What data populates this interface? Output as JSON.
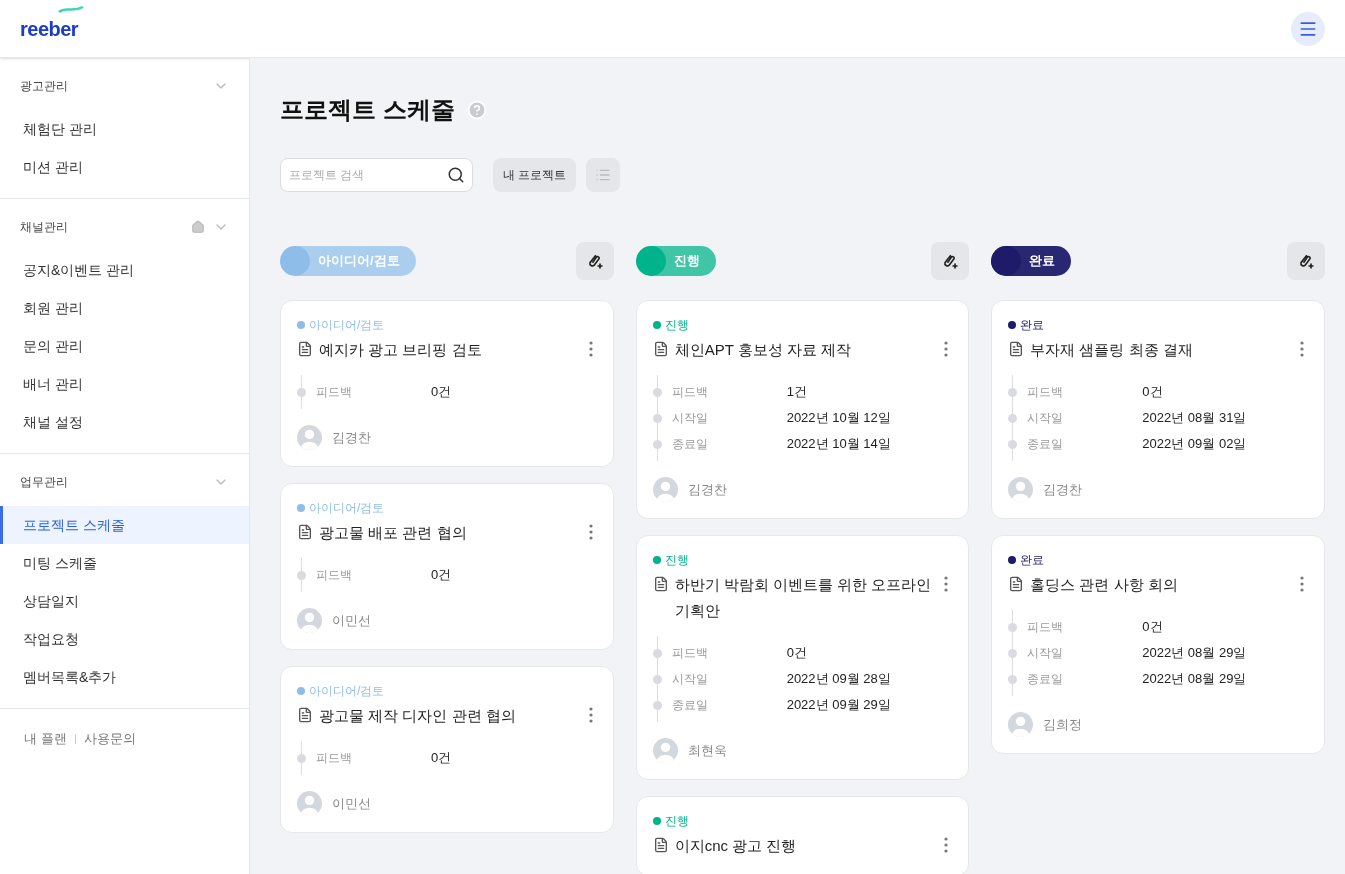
{
  "header": {
    "logo": "reeber"
  },
  "sidebar": {
    "groups": [
      {
        "title": "광고관리",
        "home": false,
        "items": [
          {
            "label": "체험단 관리",
            "selected": false
          },
          {
            "label": "미션 관리",
            "selected": false
          }
        ]
      },
      {
        "title": "채널관리",
        "home": true,
        "items": [
          {
            "label": "공지&이벤트 관리",
            "selected": false
          },
          {
            "label": "회원 관리",
            "selected": false
          },
          {
            "label": "문의 관리",
            "selected": false
          },
          {
            "label": "배너 관리",
            "selected": false
          },
          {
            "label": "채널 설정",
            "selected": false
          }
        ]
      },
      {
        "title": "업무관리",
        "home": false,
        "items": [
          {
            "label": "프로젝트 스케줄",
            "selected": true
          },
          {
            "label": "미팅 스케줄",
            "selected": false
          },
          {
            "label": "상담일지",
            "selected": false
          },
          {
            "label": "작업요청",
            "selected": false
          },
          {
            "label": "멤버목록&추가",
            "selected": false
          }
        ]
      }
    ],
    "footer_links": [
      "내 플랜",
      "사용문의"
    ]
  },
  "page": {
    "title": "프로젝트 스케줄",
    "search": {
      "placeholder": "프로젝트 검색"
    },
    "my_projects_button": "내 프로젝트"
  },
  "columns": [
    {
      "label": "아이디어/검토",
      "color": "#8fbde9",
      "cards": [
        {
          "status": "아이디어/검토",
          "title": "예지카 광고 브리핑 검토",
          "fields": [
            {
              "label": "피드백",
              "value": "0건"
            }
          ],
          "assignee": "김경찬"
        },
        {
          "status": "아이디어/검토",
          "title": "광고물 배포 관련 협의",
          "fields": [
            {
              "label": "피드백",
              "value": "0건"
            }
          ],
          "assignee": "이민선"
        },
        {
          "status": "아이디어/검토",
          "title": "광고물 제작 디자인 관련 협의",
          "fields": [
            {
              "label": "피드백",
              "value": "0건"
            }
          ],
          "assignee": "이민선"
        }
      ]
    },
    {
      "label": "진행",
      "color": "#00b38a",
      "cards": [
        {
          "status": "진행",
          "title": "체인APT 홍보성 자료 제작",
          "fields": [
            {
              "label": "피드백",
              "value": "1건"
            },
            {
              "label": "시작일",
              "value": "2022년 10월 12일"
            },
            {
              "label": "종료일",
              "value": "2022년 10월 14일"
            }
          ],
          "assignee": "김경찬"
        },
        {
          "status": "진행",
          "title": "하반기 박람회 이벤트를 위한 오프라인 기획안",
          "fields": [
            {
              "label": "피드백",
              "value": "0건"
            },
            {
              "label": "시작일",
              "value": "2022년 09월 28일"
            },
            {
              "label": "종료일",
              "value": "2022년 09월 29일"
            }
          ],
          "assignee": "최현욱"
        },
        {
          "status": "진행",
          "title": "이지cnc 광고 진행"
        }
      ]
    },
    {
      "label": "완료",
      "color": "#1e1b6b",
      "cards": [
        {
          "status": "완료",
          "title": "부자재 샘플링 최종 결재",
          "fields": [
            {
              "label": "피드백",
              "value": "0건"
            },
            {
              "label": "시작일",
              "value": "2022년 08월 31일"
            },
            {
              "label": "종료일",
              "value": "2022년 09월 02일"
            }
          ],
          "assignee": "김경찬"
        },
        {
          "status": "완료",
          "title": "홀딩스 관련 사항 회의",
          "fields": [
            {
              "label": "피드백",
              "value": "0건"
            },
            {
              "label": "시작일",
              "value": "2022년 08월 29일"
            },
            {
              "label": "종료일",
              "value": "2022년 08월 29일"
            }
          ],
          "assignee": "김희정"
        }
      ]
    }
  ]
}
